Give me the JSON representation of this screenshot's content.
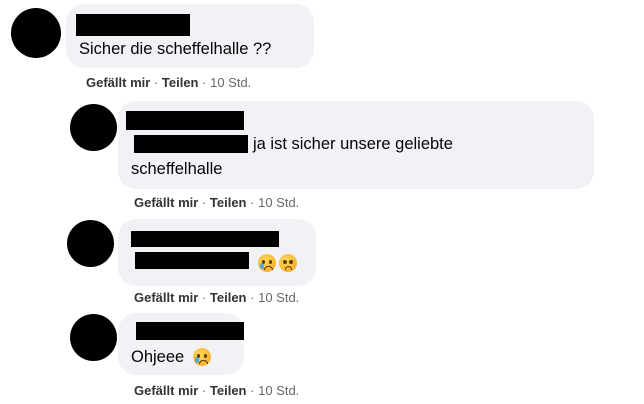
{
  "comments": [
    {
      "message": "Sicher die scheffelhalle ??",
      "like": "Gefällt mir",
      "share": "Teilen",
      "time": "10 Std."
    },
    {
      "message_line1": "ja ist sicher unsere geliebte",
      "message_line2": "scheffelhalle",
      "like": "Gefällt mir",
      "share": "Teilen",
      "time": "10 Std."
    },
    {
      "like": "Gefällt mir",
      "share": "Teilen",
      "time": "10 Std.",
      "emojis": [
        "crying-face-icon",
        "flushed-face-icon"
      ]
    },
    {
      "message": "Ohjeee",
      "like": "Gefällt mir",
      "share": "Teilen",
      "time": "10 Std.",
      "emojis": [
        "crying-face-icon"
      ]
    }
  ],
  "separator": "·",
  "colors": {
    "bubble": "#f0f2f5",
    "meta": "#65676b"
  }
}
